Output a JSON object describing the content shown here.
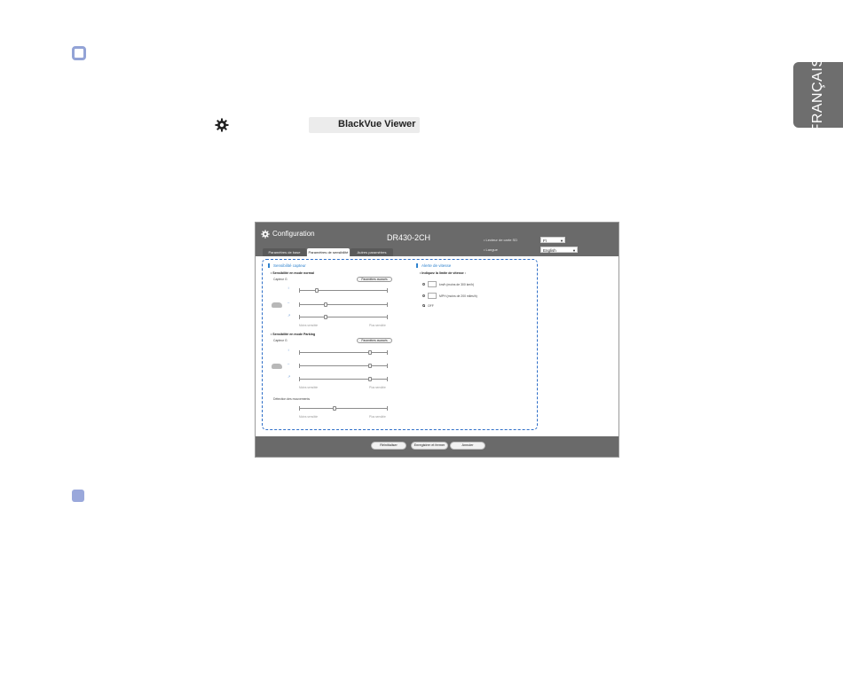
{
  "side_tab": {
    "label": "FRANÇAIS"
  },
  "viewer_badge": {
    "label": "BlackVue Viewer",
    "icon": "apple-icon"
  },
  "window": {
    "title": "Configuration",
    "model": "DR430-2CH",
    "sd_label": "Lecteur de carte SD",
    "sd_value": "F\\",
    "lang_label": "Langue",
    "lang_value": "English",
    "tabs": [
      {
        "label": "Paramètres de base",
        "active": false
      },
      {
        "label": "Paramètres de sensibilité",
        "active": true
      },
      {
        "label": "Autres paramètres",
        "active": false
      }
    ],
    "sensor": {
      "title": "Sensibilité capteur",
      "normal_title": "Sensibilité en mode normal",
      "normal_sensor": "Capteur G",
      "normal_button": "Paramètres avancés",
      "normal_sliders": [
        0.11,
        0.3,
        0.3
      ],
      "parking_title": "Sensibilité en mode Parking",
      "parking_sensor": "Capteur G",
      "parking_button": "Paramètres avancés",
      "parking_sliders": [
        0.8,
        0.8,
        0.8
      ],
      "less_label": "Moins sensible",
      "more_label": "Plus sensible",
      "motion_title": "Détection des mouvements",
      "motion_slider": 0.4
    },
    "speed": {
      "title": "Alerte de vitesse",
      "sub": "Indiquez la limite de vitesse :",
      "kmh": "km/h (moins de 300 km/h)",
      "mph": "MPH (moins de 200 miles/h)",
      "off": "OFF",
      "selected": "OFF"
    },
    "footer": {
      "reset": "Réinitialiser",
      "save": "Enregistrer et fermer",
      "cancel": "Annuler"
    }
  }
}
